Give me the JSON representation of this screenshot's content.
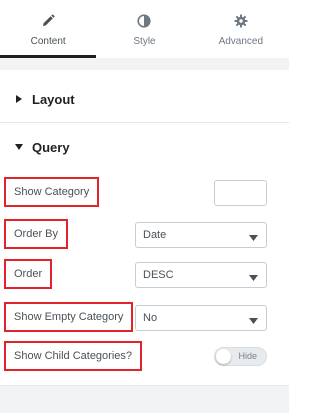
{
  "tabs": [
    {
      "label": "Content",
      "icon": "pencil-icon",
      "active": true
    },
    {
      "label": "Style",
      "icon": "half-circle-icon",
      "active": false
    },
    {
      "label": "Advanced",
      "icon": "gear-icon",
      "active": false
    }
  ],
  "sections": {
    "layout": {
      "title": "Layout",
      "icon": "caret-right-icon"
    },
    "query": {
      "title": "Query",
      "icon": "caret-down-icon"
    }
  },
  "controls": {
    "show_category": {
      "label": "Show Category",
      "value": ""
    },
    "order_by": {
      "label": "Order By",
      "value": "Date"
    },
    "order": {
      "label": "Order",
      "value": "DESC"
    },
    "show_empty_category": {
      "label": "Show Empty Category",
      "value": "No"
    },
    "show_child_categories": {
      "label": "Show Child Categories?",
      "toggle_text": "Hide",
      "enabled": false
    }
  },
  "colors": {
    "highlight_border": "#e2232a",
    "active_tab_underline": "#1f1f1f",
    "panel_strip": "#f1f3f5"
  }
}
